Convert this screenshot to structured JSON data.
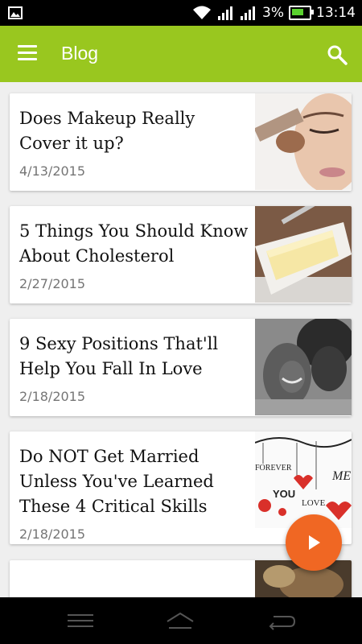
{
  "status_bar": {
    "battery_pct": "3%",
    "time": "13:14",
    "battery_color": "#5ad12f"
  },
  "app_bar": {
    "title": "Blog",
    "color": "#99c71f",
    "menu_icon": "hamburger-menu-icon",
    "search_icon": "search-icon"
  },
  "posts": [
    {
      "title": "Does Makeup Really Cover it up?",
      "date": "4/13/2015",
      "thumb": "makeup-brush-face-photo"
    },
    {
      "title": "5 Things You Should Know About Cholesterol",
      "date": "2/27/2015",
      "thumb": "butter-dish-photo"
    },
    {
      "title": "9 Sexy Positions That'll Help You Fall In Love",
      "date": "2/18/2015",
      "thumb": "couple-embrace-photo"
    },
    {
      "title": "Do NOT Get Married Unless You've Learned These 4 Critical Skills",
      "date": "2/18/2015",
      "thumb": "forever-you-love-me-hearts-photo"
    },
    {
      "title": "",
      "date": "",
      "thumb": "partial-photo"
    }
  ],
  "thumb_labels": {
    "forever": "FOREVER",
    "you": "YOU",
    "love": "LOVE",
    "me": "ME"
  },
  "fab": {
    "icon": "play-icon",
    "color": "#f06723"
  },
  "nav_bar": {
    "recent_icon": "recent-apps-icon",
    "home_icon": "home-icon",
    "back_icon": "back-icon"
  }
}
